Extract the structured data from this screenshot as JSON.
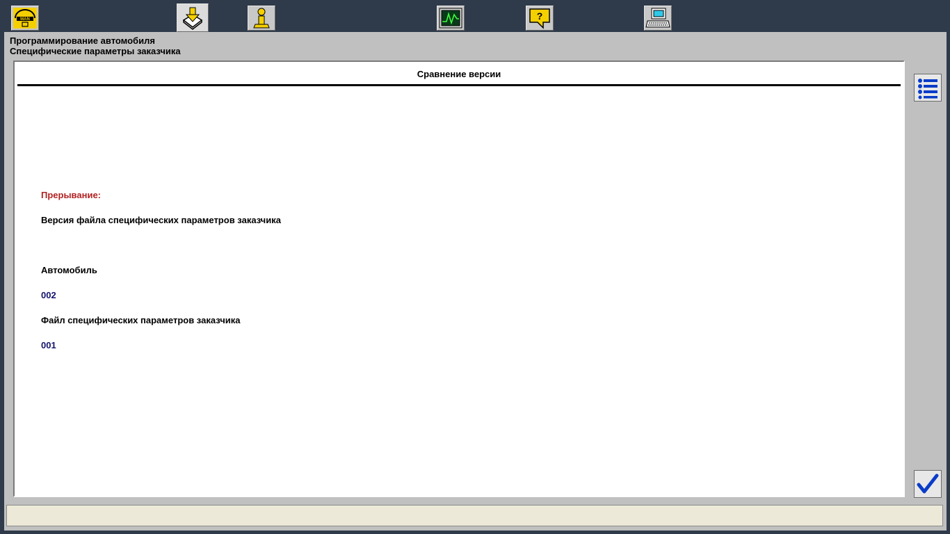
{
  "header": {
    "line1": "Программирование автомобиля",
    "line2": "Специфические параметры заказчика"
  },
  "toolbar": {
    "icons": [
      "man-logo-icon",
      "download-book-icon",
      "info-person-icon",
      "oscilloscope-icon",
      "help-icon",
      "computer-icon"
    ]
  },
  "content": {
    "title": "Сравнение версии",
    "interrupt_label": "Прерывание:",
    "version_desc": "Версия файла специфических параметров заказчика",
    "vehicle_label": "Автомобиль",
    "vehicle_value": "002",
    "file_label": "Файл специфических параметров заказчика",
    "file_value": "001"
  },
  "colors": {
    "background": "#2f3a4a",
    "panel": "#c0c0c0",
    "accent_yellow": "#f5d000",
    "interrupt_red": "#b22222",
    "value_blue": "#14146e",
    "check_blue": "#0a3cc8"
  },
  "statusbar": {
    "text": ""
  }
}
